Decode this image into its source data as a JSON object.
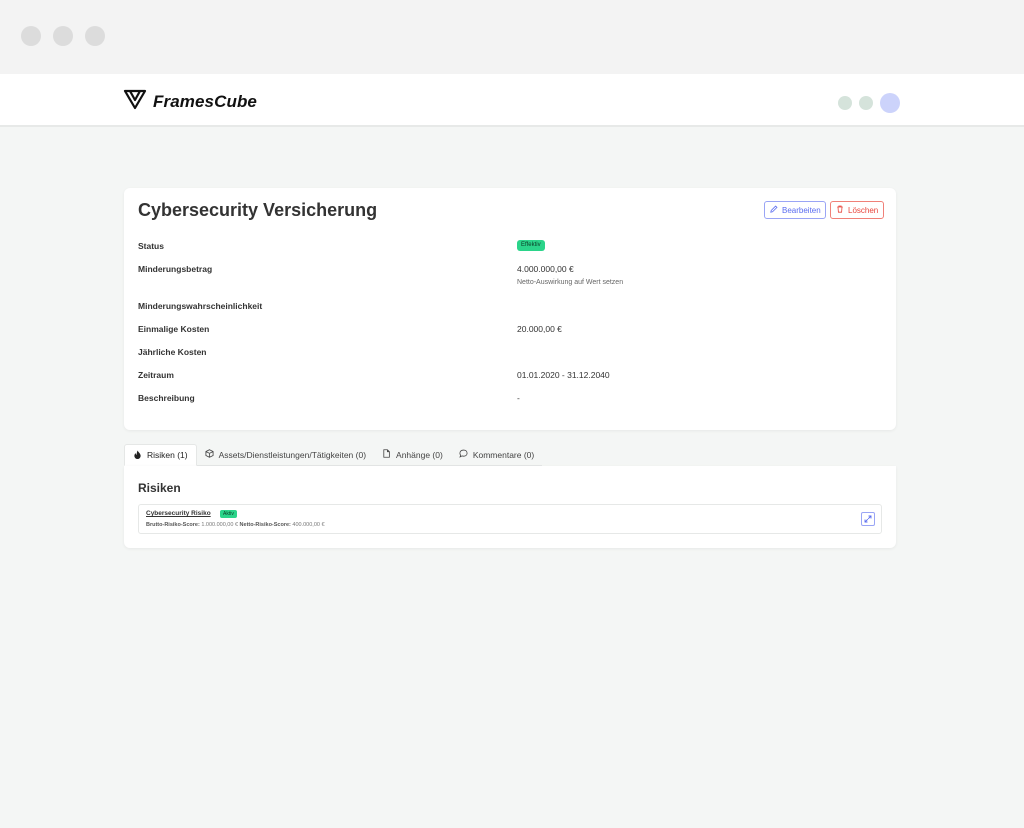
{
  "app": {
    "name": "FramesCube"
  },
  "colors": {
    "accent": "#5a6cf0",
    "danger": "#e8453c",
    "success": "#2bd48a"
  },
  "detail": {
    "title": "Cybersecurity Versicherung",
    "edit_label": "Bearbeiten",
    "delete_label": "Löschen",
    "fields": [
      {
        "label": "Status",
        "badge": "Effektiv"
      },
      {
        "label": "Minderungsbetrag",
        "value": "4.000.000,00 €",
        "sub": "Netto-Auswirkung auf Wert setzen"
      },
      {
        "label": "Minderungswahrscheinlichkeit",
        "value": ""
      },
      {
        "label": "Einmalige Kosten",
        "value": "20.000,00 €"
      },
      {
        "label": "Jährliche Kosten",
        "value": ""
      },
      {
        "label": "Zeitraum",
        "value": "01.01.2020 - 31.12.2040"
      },
      {
        "label": "Beschreibung",
        "value": "-"
      }
    ]
  },
  "tabs": [
    {
      "label": "Risiken (1)",
      "icon": "flame-icon"
    },
    {
      "label": "Assets/Dienstleistungen/Tätigkeiten (0)",
      "icon": "box-icon"
    },
    {
      "label": "Anhänge (0)",
      "icon": "file-icon"
    },
    {
      "label": "Kommentare (0)",
      "icon": "comment-icon"
    }
  ],
  "risks": {
    "title": "Risiken",
    "items": [
      {
        "name": "Cybersecurity Risiko",
        "badge": "Aktiv",
        "gross_label": "Brutto-Risiko-Score:",
        "gross_value": "1.000.000,00 €",
        "net_label": "Netto-Risiko-Score:",
        "net_value": "400.000,00 €"
      }
    ]
  }
}
